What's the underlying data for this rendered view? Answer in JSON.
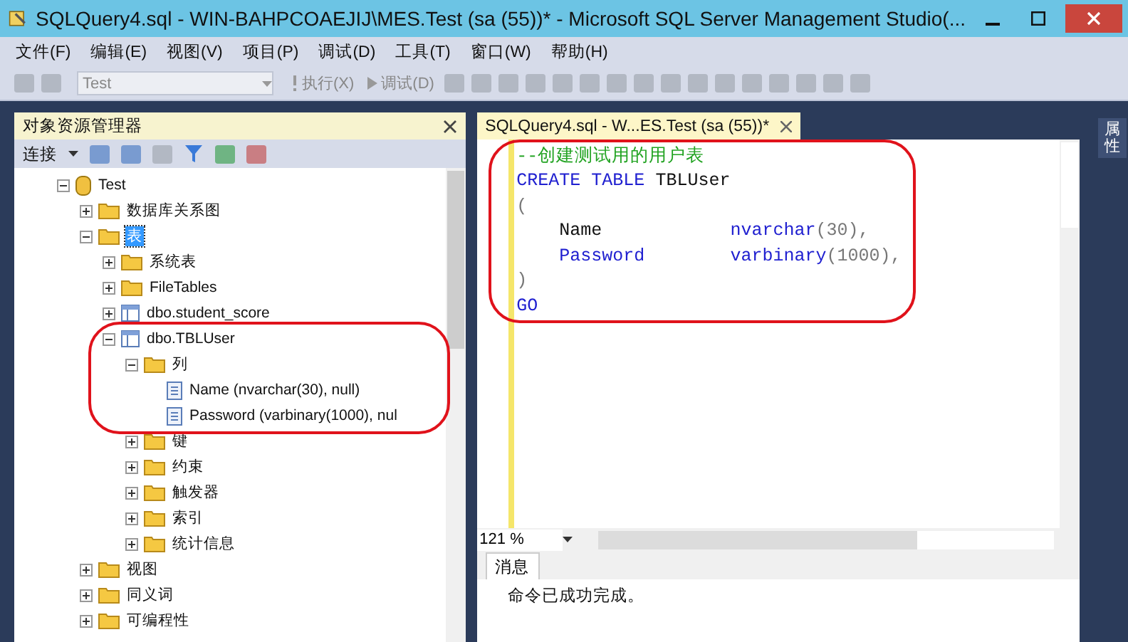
{
  "window": {
    "title": "SQLQuery4.sql - WIN-BAHPCOAEJIJ\\MES.Test (sa (55))* - Microsoft SQL Server Management Studio(..."
  },
  "menu": [
    "文件(F)",
    "编辑(E)",
    "视图(V)",
    "项目(P)",
    "调试(D)",
    "工具(T)",
    "窗口(W)",
    "帮助(H)"
  ],
  "toolbar": {
    "database": "Test",
    "execute": "执行(X)",
    "debug": "调试(D)"
  },
  "object_explorer": {
    "title": "对象资源管理器",
    "connect": "连接",
    "tree": [
      {
        "label": "Test",
        "kind": "database",
        "expanded": true,
        "selected": false,
        "children": [
          {
            "label": "数据库关系图",
            "kind": "folder",
            "expanded": false,
            "selected": false
          },
          {
            "label": "表",
            "kind": "folder",
            "expanded": true,
            "selected": true,
            "children": [
              {
                "label": "系统表",
                "kind": "folder",
                "expanded": false,
                "selected": false
              },
              {
                "label": "FileTables",
                "kind": "folder",
                "expanded": false,
                "selected": false
              },
              {
                "label": "dbo.student_score",
                "kind": "table",
                "expanded": false,
                "selected": false
              },
              {
                "label": "dbo.TBLUser",
                "kind": "table",
                "expanded": true,
                "selected": false,
                "children": [
                  {
                    "label": "列",
                    "kind": "folder",
                    "expanded": true,
                    "selected": false,
                    "children": [
                      {
                        "label": "Name (nvarchar(30), null)",
                        "kind": "column",
                        "selected": false
                      },
                      {
                        "label": "Password (varbinary(1000), nul",
                        "kind": "column",
                        "selected": false
                      }
                    ]
                  },
                  {
                    "label": "键",
                    "kind": "folder",
                    "expanded": false,
                    "selected": false
                  },
                  {
                    "label": "约束",
                    "kind": "folder",
                    "expanded": false,
                    "selected": false
                  },
                  {
                    "label": "触发器",
                    "kind": "folder",
                    "expanded": false,
                    "selected": false
                  },
                  {
                    "label": "索引",
                    "kind": "folder",
                    "expanded": false,
                    "selected": false
                  },
                  {
                    "label": "统计信息",
                    "kind": "folder",
                    "expanded": false,
                    "selected": false
                  }
                ]
              }
            ]
          },
          {
            "label": "视图",
            "kind": "folder",
            "expanded": false,
            "selected": false
          },
          {
            "label": "同义词",
            "kind": "folder",
            "expanded": false,
            "selected": false
          },
          {
            "label": "可编程性",
            "kind": "folder",
            "expanded": false,
            "selected": false
          }
        ]
      }
    ]
  },
  "editor": {
    "tab": "SQLQuery4.sql - W...ES.Test (sa (55))*",
    "zoom": "121 %",
    "lines": [
      [
        {
          "text": "--创建测试用的用户表",
          "kind": "comment"
        }
      ],
      [
        {
          "text": "CREATE TABLE",
          "kind": "keyword"
        },
        {
          "text": " TBLUser",
          "kind": "plain"
        }
      ],
      [
        {
          "text": "(",
          "kind": "punct"
        }
      ],
      [
        {
          "text": "    Name            ",
          "kind": "plain"
        },
        {
          "text": "nvarchar",
          "kind": "keyword"
        },
        {
          "text": "(30),",
          "kind": "punct"
        }
      ],
      [
        {
          "text": "    Password        ",
          "kind": "keyword"
        },
        {
          "text": "varbinary",
          "kind": "keyword"
        },
        {
          "text": "(1000),",
          "kind": "punct"
        }
      ],
      [
        {
          "text": ")",
          "kind": "punct"
        }
      ],
      [
        {
          "text": "GO",
          "kind": "keyword"
        }
      ]
    ]
  },
  "results": {
    "tab": "消息",
    "message": "命令已成功完成。"
  },
  "side_tab": "属性"
}
